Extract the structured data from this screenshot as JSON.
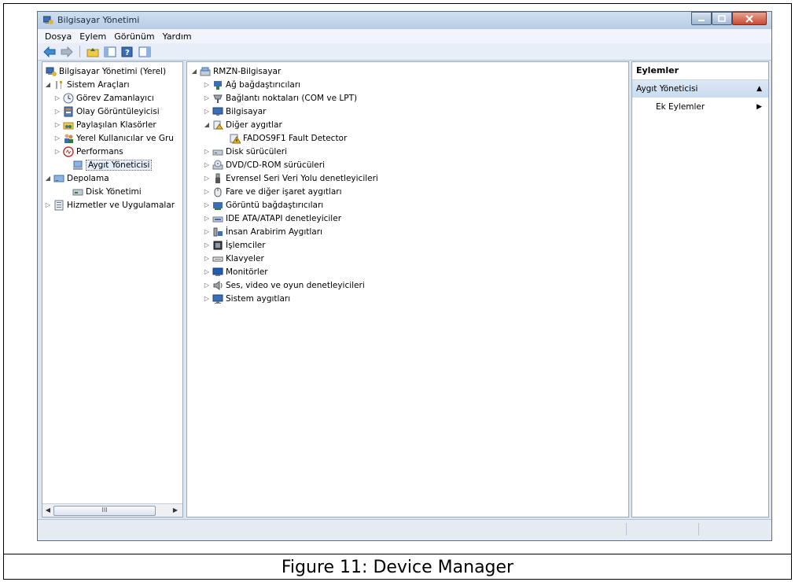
{
  "window": {
    "title": "Bilgisayar Yönetimi"
  },
  "menu": [
    "Dosya",
    "Eylem",
    "Görünüm",
    "Yardım"
  ],
  "left_tree": [
    {
      "label": "Bilgisayar Yönetimi (Yerel)",
      "icon": "computer-management-icon"
    },
    {
      "label": "Sistem Araçları",
      "icon": "tools-icon"
    },
    {
      "label": "Görev Zamanlayıcı",
      "icon": "clock-icon"
    },
    {
      "label": "Olay Görüntüleyicisi",
      "icon": "event-viewer-icon"
    },
    {
      "label": "Paylaşılan Klasörler",
      "icon": "shared-folder-icon"
    },
    {
      "label": "Yerel Kullanıcılar ve Gru",
      "icon": "users-icon"
    },
    {
      "label": "Performans",
      "icon": "performance-icon"
    },
    {
      "label": "Aygıt Yöneticisi",
      "icon": "device-manager-icon"
    },
    {
      "label": "Depolama",
      "icon": "storage-icon"
    },
    {
      "label": "Disk Yönetimi",
      "icon": "disk-icon"
    },
    {
      "label": "Hizmetler ve Uygulamalar",
      "icon": "services-icon"
    }
  ],
  "device_tree": {
    "root": "RMZN-Bilgisayar",
    "items": [
      "Ağ bağdaştırıcıları",
      "Bağlantı noktaları (COM ve LPT)",
      "Bilgisayar",
      "Diğer aygıtlar",
      "FADOS9F1 Fault Detector",
      "Disk sürücüleri",
      "DVD/CD-ROM sürücüleri",
      "Evrensel Seri Veri Yolu denetleyicileri",
      "Fare ve diğer işaret aygıtları",
      "Görüntü bağdaştırıcıları",
      "IDE ATA/ATAPI denetleyiciler",
      "İnsan Arabirim Aygıtları",
      "İşlemciler",
      "Klavyeler",
      "Monitörler",
      "Ses, video ve oyun denetleyicileri",
      "Sistem aygıtları"
    ]
  },
  "actions": {
    "header": "Eylemler",
    "section": "Aygıt Yöneticisi",
    "link": "Ek Eylemler"
  },
  "scrollbar": {
    "thumb_grip": "III"
  },
  "caption": "Figure 11: Device Manager",
  "colors": {
    "accent": "#3a6ea5",
    "warning": "#e8b32a",
    "selection": "#e5f0fb"
  }
}
